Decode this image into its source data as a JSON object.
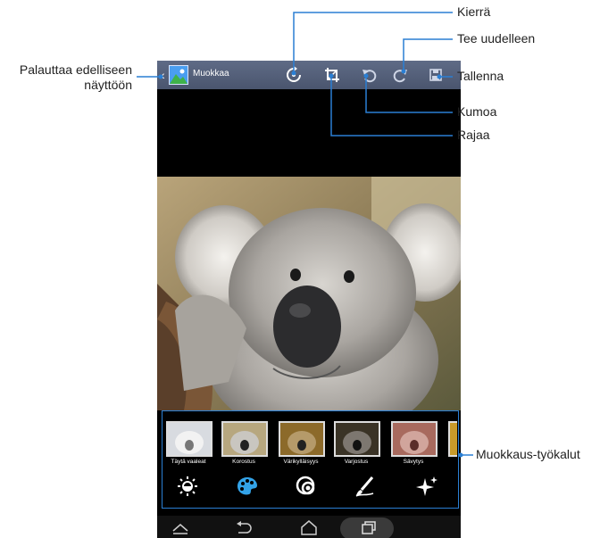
{
  "header": {
    "title": "Muokkaa"
  },
  "toolbar_icons": [
    "rotate-icon",
    "crop-icon",
    "undo-icon",
    "redo-icon",
    "save-icon"
  ],
  "filters": [
    {
      "label": "Täytä vaaleat"
    },
    {
      "label": "Korostus"
    },
    {
      "label": "Värikylläisyys"
    },
    {
      "label": "Varjostus"
    },
    {
      "label": "Sävytys"
    }
  ],
  "tools": [
    "brightness-icon",
    "palette-icon",
    "circles-icon",
    "brush-icon",
    "sparkle-icon"
  ],
  "nav": [
    "home-roof-icon",
    "back-icon",
    "home-icon",
    "recent-apps-icon"
  ],
  "callouts": {
    "back": "Palauttaa edelliseen",
    "back_line2": "näyttöön",
    "rotate": "Kierrä",
    "redo": "Tee uudelleen",
    "save": "Tallenna",
    "undo": "Kumoa",
    "crop": "Rajaa",
    "tools": "Muokkaus-työkalut"
  },
  "colors": {
    "accent": "#2a7fd4",
    "topbar": "#56617b",
    "tool_active": "#33a3e8"
  }
}
